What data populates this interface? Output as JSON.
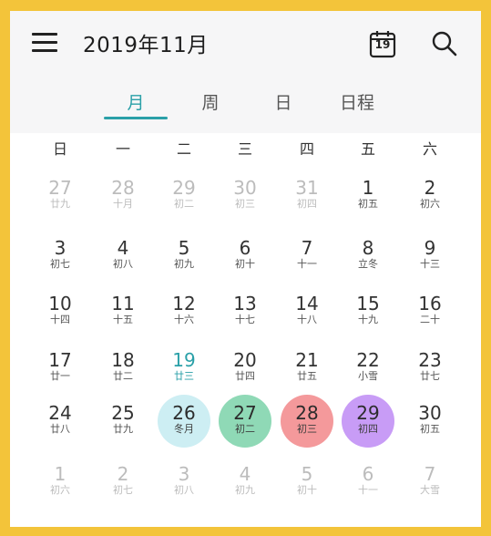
{
  "header": {
    "title": "2019年11月",
    "calendar_icon_number": "19"
  },
  "tabs": [
    {
      "label": "月",
      "active": true
    },
    {
      "label": "周",
      "active": false
    },
    {
      "label": "日",
      "active": false
    },
    {
      "label": "日程",
      "active": false
    }
  ],
  "weekdays": [
    "日",
    "一",
    "二",
    "三",
    "四",
    "五",
    "六"
  ],
  "weeks": [
    [
      {
        "day": "27",
        "lunar": "廿九",
        "muted": true
      },
      {
        "day": "28",
        "lunar": "十月",
        "muted": true
      },
      {
        "day": "29",
        "lunar": "初二",
        "muted": true
      },
      {
        "day": "30",
        "lunar": "初三",
        "muted": true
      },
      {
        "day": "31",
        "lunar": "初四",
        "muted": true
      },
      {
        "day": "1",
        "lunar": "初五"
      },
      {
        "day": "2",
        "lunar": "初六"
      }
    ],
    [
      {
        "day": "3",
        "lunar": "初七"
      },
      {
        "day": "4",
        "lunar": "初八"
      },
      {
        "day": "5",
        "lunar": "初九"
      },
      {
        "day": "6",
        "lunar": "初十"
      },
      {
        "day": "7",
        "lunar": "十一"
      },
      {
        "day": "8",
        "lunar": "立冬"
      },
      {
        "day": "9",
        "lunar": "十三"
      }
    ],
    [
      {
        "day": "10",
        "lunar": "十四"
      },
      {
        "day": "11",
        "lunar": "十五"
      },
      {
        "day": "12",
        "lunar": "十六"
      },
      {
        "day": "13",
        "lunar": "十七"
      },
      {
        "day": "14",
        "lunar": "十八"
      },
      {
        "day": "15",
        "lunar": "十九"
      },
      {
        "day": "16",
        "lunar": "二十"
      }
    ],
    [
      {
        "day": "17",
        "lunar": "廿一"
      },
      {
        "day": "18",
        "lunar": "廿二"
      },
      {
        "day": "19",
        "lunar": "廿三",
        "today": true
      },
      {
        "day": "20",
        "lunar": "廿四"
      },
      {
        "day": "21",
        "lunar": "廿五"
      },
      {
        "day": "22",
        "lunar": "小雪"
      },
      {
        "day": "23",
        "lunar": "廿七"
      }
    ],
    [
      {
        "day": "24",
        "lunar": "廿八"
      },
      {
        "day": "25",
        "lunar": "廿九"
      },
      {
        "day": "26",
        "lunar": "冬月",
        "circle": "#cdeef3"
      },
      {
        "day": "27",
        "lunar": "初二",
        "circle": "#8fd9b6"
      },
      {
        "day": "28",
        "lunar": "初三",
        "circle": "#f4999b"
      },
      {
        "day": "29",
        "lunar": "初四",
        "circle": "#c89cf6"
      },
      {
        "day": "30",
        "lunar": "初五"
      }
    ],
    [
      {
        "day": "1",
        "lunar": "初六",
        "muted": true
      },
      {
        "day": "2",
        "lunar": "初七",
        "muted": true
      },
      {
        "day": "3",
        "lunar": "初八",
        "muted": true
      },
      {
        "day": "4",
        "lunar": "初九",
        "muted": true
      },
      {
        "day": "5",
        "lunar": "初十",
        "muted": true
      },
      {
        "day": "6",
        "lunar": "十一",
        "muted": true
      },
      {
        "day": "7",
        "lunar": "大雪",
        "muted": true
      }
    ]
  ],
  "colors": {
    "frame": "#f3c43a",
    "accent": "#2aa0a8",
    "muted_text": "#bcbcbc"
  }
}
